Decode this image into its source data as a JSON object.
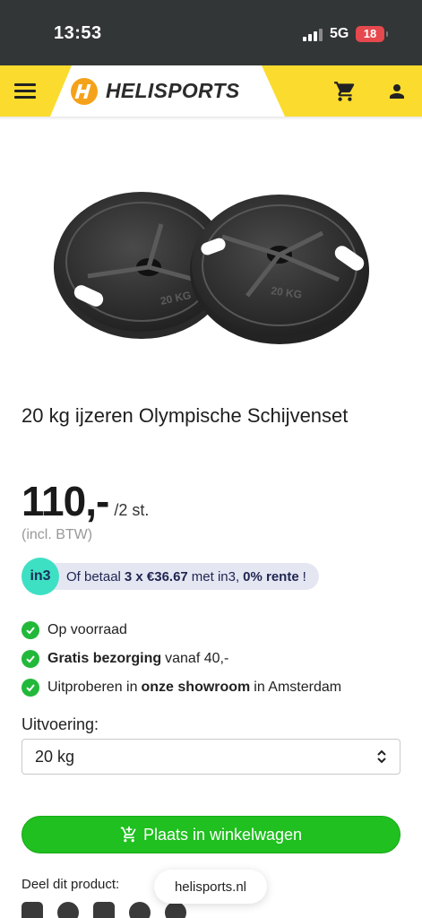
{
  "status_bar": {
    "time": "13:53",
    "network": "5G",
    "battery": "18"
  },
  "header": {
    "brand": "HELISPORTS",
    "colors": {
      "background": "#fbdc2e",
      "logo_orange": "#f5a21b"
    },
    "icons": [
      "menu-icon",
      "cart-icon",
      "user-icon"
    ]
  },
  "product": {
    "title": "20 kg ijzeren Olympische Schijvenset",
    "price": "110,-",
    "price_unit": "/2 st.",
    "vat_note": "(incl. BTW)",
    "image_plate_labels": [
      "20 KG",
      "20 KG"
    ]
  },
  "in3": {
    "logo": "in3",
    "prefix": "Of betaal",
    "installments": "3 x €36.67",
    "middle": "met in3,",
    "rate": "0% rente",
    "suffix": "!"
  },
  "usps": [
    {
      "bold": "",
      "text": "Op voorraad"
    },
    {
      "bold": "Gratis bezorging",
      "text": "vanaf 40,-"
    },
    {
      "pre": "Uitproberen in",
      "bold": "onze showroom",
      "text": "in Amsterdam"
    }
  ],
  "variant": {
    "label": "Uitvoering:",
    "selected": "20 kg"
  },
  "cart_button": {
    "label": "Plaats in winkelwagen",
    "color": "#1fc01f"
  },
  "share": {
    "label": "Deel dit product:",
    "icons": [
      "mail-icon",
      "facebook-icon",
      "instagram-icon",
      "pinterest-icon",
      "whatsapp-icon"
    ]
  },
  "browser": {
    "url": "helisports.nl"
  }
}
